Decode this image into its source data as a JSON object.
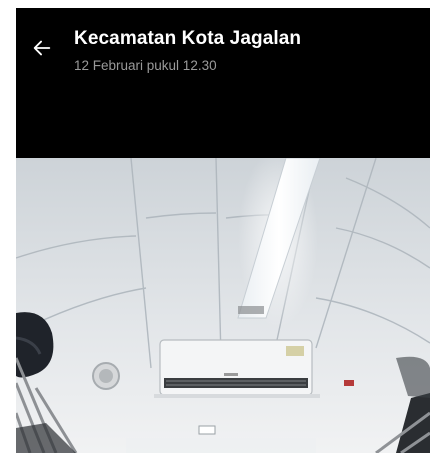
{
  "header": {
    "title": "Kecamatan Kota Jagalan",
    "subtitle": "12 Februari pukul 12.30"
  },
  "icons": {
    "back": "arrow-left-icon"
  },
  "photo": {
    "subject": "",
    "overlay_color": "#000000"
  }
}
